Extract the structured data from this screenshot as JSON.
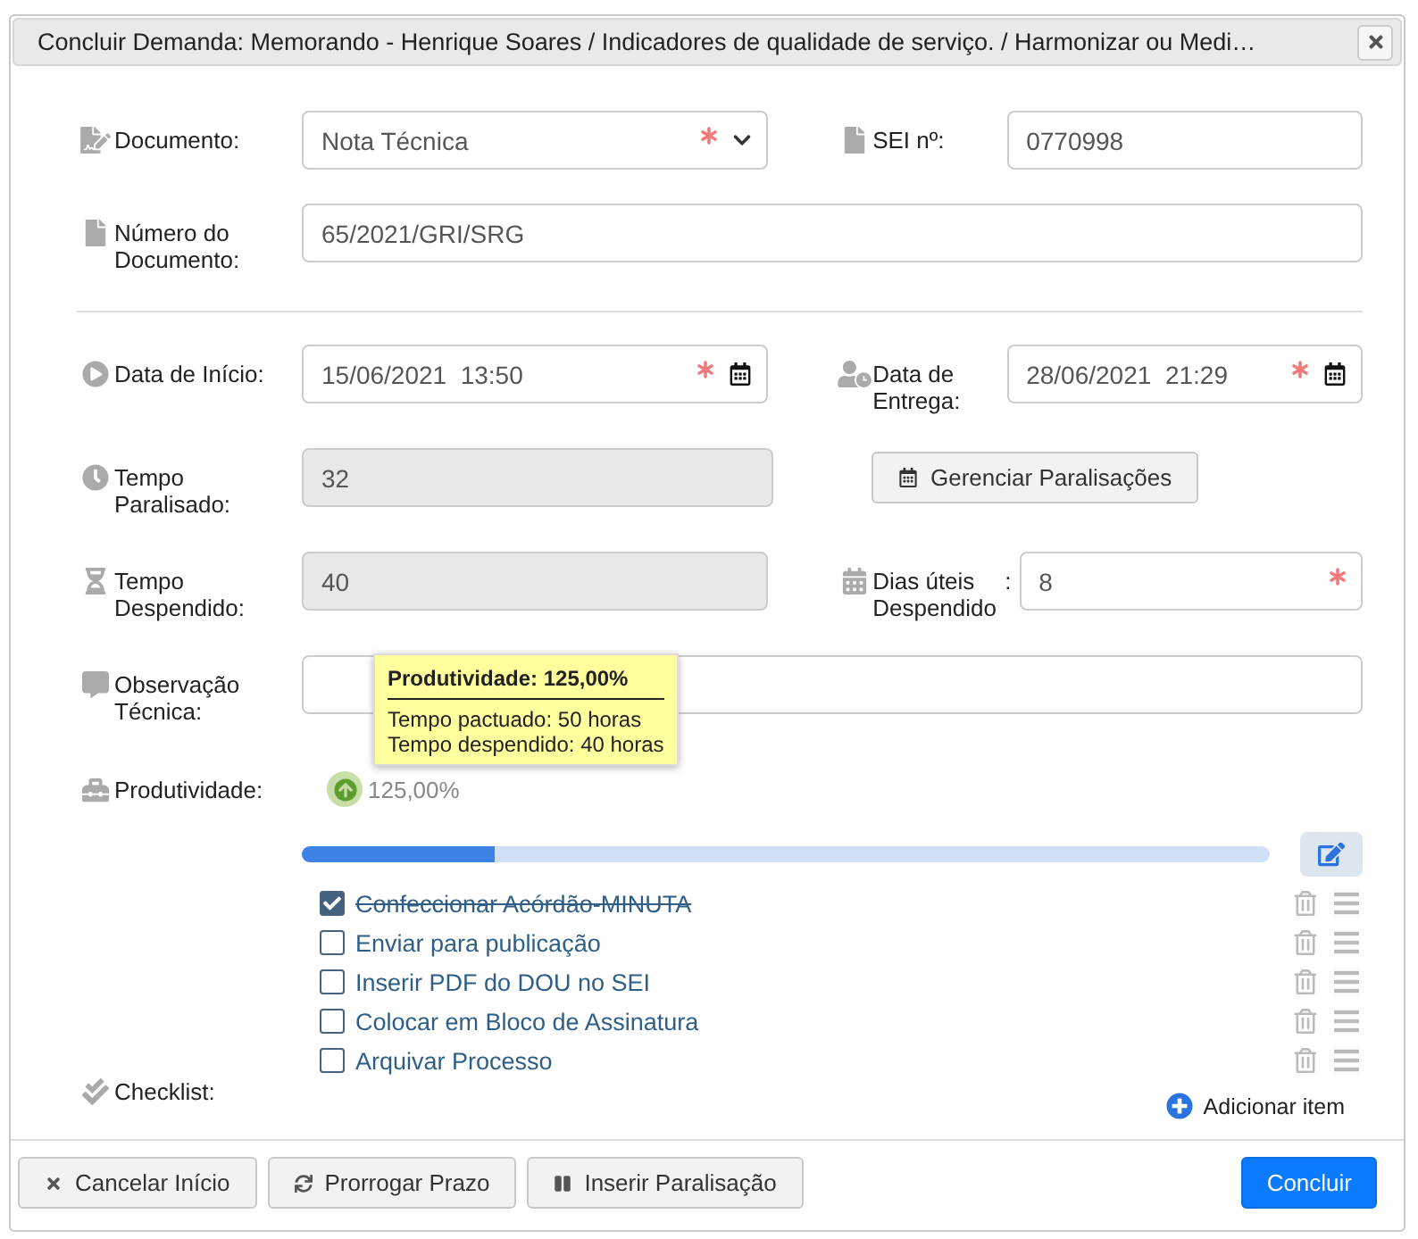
{
  "dialog": {
    "title": "Concluir Demanda: Memorando - Henrique Soares / Indicadores de qualidade de serviço. / Harmonizar ou Medi…"
  },
  "sections": [
    [
      [
        {
          "label": "Documento:",
          "kind": "select",
          "value": "Nota Técnica",
          "required": true
        },
        {
          "label": "SEI nº:",
          "kind": "text",
          "value": "0770998",
          "required": false
        }
      ],
      [
        {
          "label": "Número do Documento:",
          "kind": "text",
          "value": "65/2021/GRI/SRG",
          "required": false
        }
      ]
    ],
    [
      [
        {
          "label": "Data de Início:",
          "kind": "datetime",
          "value": "15/06/2021  13:50",
          "required": true
        },
        {
          "label": "Data de Entrega:",
          "kind": "datetime",
          "value": "28/06/2021  21:29",
          "required": true
        }
      ],
      [
        {
          "label": "Tempo Paralisado:",
          "kind": "text",
          "value": "32",
          "required": false,
          "disabled": true
        },
        {
          "label": "Gerenciar Paralisações",
          "kind": "button"
        }
      ],
      [
        {
          "label": "Tempo Despendido:",
          "kind": "text",
          "value": "40",
          "required": false,
          "disabled": true
        },
        {
          "label": "Dias úteis Despendido",
          "separator": ":",
          "kind": "text",
          "value": "8",
          "required": true
        }
      ],
      [
        {
          "label": "Observação Técnica:",
          "kind": "text",
          "required": false
        }
      ]
    ]
  ],
  "productivity": {
    "label": "Produtividade:",
    "value": "125,00%",
    "tooltip": {
      "title": "Produtividade: 125,00%",
      "lines": [
        "Tempo pactuado: 50 horas",
        "Tempo despendido: 40 horas"
      ]
    }
  },
  "checklist": {
    "label": "Checklist:",
    "level": 0.2,
    "items": [
      {
        "label": "Confeccionar Acórdão-MINUTA",
        "checked": true
      },
      {
        "label": "Enviar para publicação",
        "checked": false
      },
      {
        "label": "Inserir PDF do DOU no SEI",
        "checked": false
      },
      {
        "label": "Colocar em Bloco de Assinatura",
        "checked": false
      },
      {
        "label": "Arquivar Processo",
        "checked": false
      }
    ],
    "add": "Adicionar item"
  },
  "footer": [
    {
      "label": "Cancelar Início",
      "kind": "cancel"
    },
    {
      "label": "Prorrogar Prazo",
      "kind": "extend"
    },
    {
      "label": "Inserir Paralisação",
      "kind": "pause"
    },
    {
      "label": "Concluir",
      "kind": "primary"
    }
  ]
}
